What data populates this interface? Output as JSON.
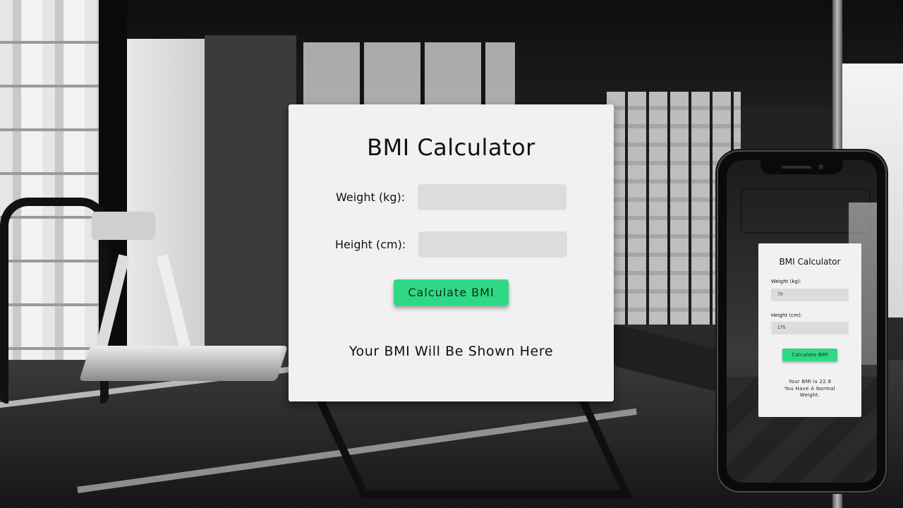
{
  "app": {
    "title": "BMI Calculator"
  },
  "form": {
    "weight_label": "Weight (kg):",
    "weight_value": "",
    "height_label": "Height (cm):",
    "height_value": "",
    "calculate_label": "Calculate BMI",
    "result_text": "Your BMI Will Be Shown Here"
  },
  "phone_preview": {
    "title": "BMI Calculator",
    "weight_label": "Weight (kg):",
    "weight_value": "70",
    "height_label": "Height (cm):",
    "height_value": "175",
    "calculate_label": "Calculate BMI",
    "result_line1": "Your BMI is 22.9",
    "result_line2": "You Have A Normal",
    "result_line3": "Weight."
  },
  "colors": {
    "accent": "#2fd884",
    "card_bg": "#f1f1f1",
    "input_bg": "#dcdcdc"
  }
}
